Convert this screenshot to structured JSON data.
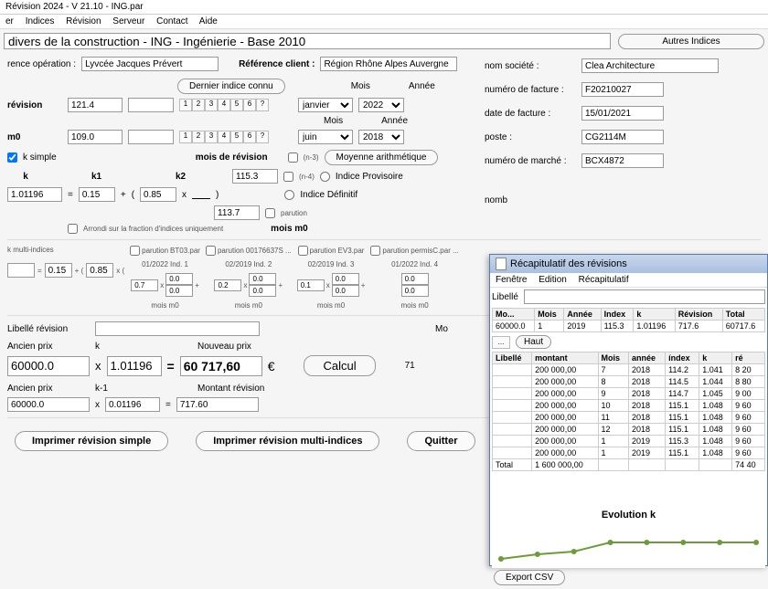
{
  "title": "Révision 2024 - V 21.10 - ING.par",
  "menu": [
    "er",
    "Indices",
    "Révision",
    "Serveur",
    "Contact",
    "Aide"
  ],
  "topbar": {
    "desc": "divers de la construction - ING - Ingénierie - Base 2010",
    "autres": "Autres Indices"
  },
  "refop_lbl": "rence opération :",
  "refop_val": "Lyvcée Jacques Prévert",
  "refcl_lbl": "Référence client :",
  "refcl_val": "Région Rhône Alpes Auvergne",
  "dernier": "Dernier indice connu",
  "mois": "Mois",
  "annee": "Année",
  "revision_lbl": "révision",
  "revision_val": "121.4",
  "rev_mois": "janvier",
  "rev_annee": "2022",
  "m0_lbl": "m0",
  "m0_val": "109.0",
  "m0_mois": "juin",
  "m0_annee": "2018",
  "ksimple": "k simple",
  "k_lbl": "k",
  "k1_lbl": "k1",
  "k2_lbl": "k2",
  "mois_rev": "mois de révision",
  "moy": "Moyenne arithmétique",
  "prov": "Indice Provisoire",
  "def": "Indice Définitif",
  "kval": "1.01196",
  "k1v": "0.15",
  "k2v": "0.85",
  "num1": "115.3",
  "num2": "113.7",
  "arrondi": "Arrondi sur la fraction d'indices uniquement",
  "moism0": "mois m0",
  "kmulti": "k multi-indices",
  "parution": "parution",
  "multi": {
    "k1": "0.15",
    "k2": "0.85",
    "cells": [
      {
        "file": "BT03.par",
        "date": "01/2022",
        "ind": "Ind. 1",
        "up": "0.0",
        "dn": "0.0",
        "coef": "0.7"
      },
      {
        "file": "00176637S ...",
        "date": "02/2019",
        "ind": "Ind. 2",
        "up": "0.0",
        "dn": "0.0",
        "coef": "0.2"
      },
      {
        "file": "EV3.par",
        "date": "02/2019",
        "ind": "Ind. 3",
        "up": "0.0",
        "dn": "0.0",
        "coef": "0.1"
      },
      {
        "file": "permisC.par ...",
        "date": "01/2022",
        "ind": "Ind. 4",
        "up": "0.0",
        "dn": "0.0",
        "coef": ""
      }
    ]
  },
  "libelle_rev": "Libellé révision",
  "ancien": "Ancien prix",
  "nouveau": "Nouveau prix",
  "ancien_v": "60000.0",
  "kcalc": "1.01196",
  "nouveau_v": "60 717,60",
  "eur": "€",
  "calcul": "Calcul",
  "km1": "k-1",
  "montant_rev": "Montant révision",
  "ancien2": "60000.0",
  "km1v": "0.01196",
  "mrev": "717.60",
  "print1": "Imprimer révision simple",
  "print2": "Imprimer révision multi-indices",
  "quit": "Quitter",
  "right": {
    "soc_lbl": "nom société :",
    "soc": "Clea Architecture",
    "fac_lbl": "numéro de facture :",
    "fac": "F20210027",
    "date_lbl": "date de facture :",
    "date": "15/01/2021",
    "poste_lbl": "poste :",
    "poste": "CG2114M",
    "marche_lbl": "numéro de marché :",
    "marche": "BCX4872",
    "nomb": "nomb"
  },
  "recap": {
    "title": "Récapitulatif des révisions",
    "menu": [
      "Fenêtre",
      "Edition",
      "Récapitulatif"
    ],
    "libelle": "Libellé",
    "haut": "Haut",
    "back": "...",
    "cols1": [
      "Mo...",
      "Mois",
      "Année",
      "Index",
      "k",
      "Révision",
      "Total"
    ],
    "row1": [
      "60000.0",
      "1",
      "2019",
      "115.3",
      "1.01196",
      "717.6",
      "60717.6"
    ],
    "cols2": [
      "Libellé",
      "montant",
      "Mois",
      "année",
      "índex",
      "k",
      "ré"
    ],
    "rows": [
      [
        "",
        "200 000,00",
        "7",
        "2018",
        "114.2",
        "1.041",
        "8 20"
      ],
      [
        "",
        "200 000,00",
        "8",
        "2018",
        "114.5",
        "1.044",
        "8 80"
      ],
      [
        "",
        "200 000,00",
        "9",
        "2018",
        "114.7",
        "1.045",
        "9 00"
      ],
      [
        "",
        "200 000,00",
        "10",
        "2018",
        "115.1",
        "1.048",
        "9 60"
      ],
      [
        "",
        "200 000,00",
        "11",
        "2018",
        "115.1",
        "1.048",
        "9 60"
      ],
      [
        "",
        "200 000,00",
        "12",
        "2018",
        "115.1",
        "1.048",
        "9 60"
      ],
      [
        "",
        "200 000,00",
        "1",
        "2019",
        "115.3",
        "1.048",
        "9 60"
      ],
      [
        "",
        "200 000,00",
        "1",
        "2019",
        "115.1",
        "1.048",
        "9 60"
      ],
      [
        "Total",
        "1 600 000,00",
        "",
        "",
        "",
        "",
        "74 40"
      ]
    ],
    "evo": "Evolution k",
    "export": "Export CSV"
  },
  "chart_data": {
    "type": "line",
    "title": "Evolution k",
    "x": [
      1,
      2,
      3,
      4,
      5,
      6,
      7,
      8
    ],
    "values": [
      1.041,
      1.044,
      1.045,
      1.048,
      1.048,
      1.048,
      1.048,
      1.048
    ],
    "ylim": [
      1.04,
      1.05
    ]
  },
  "mon_lbl": "Mo",
  "t71": "71"
}
